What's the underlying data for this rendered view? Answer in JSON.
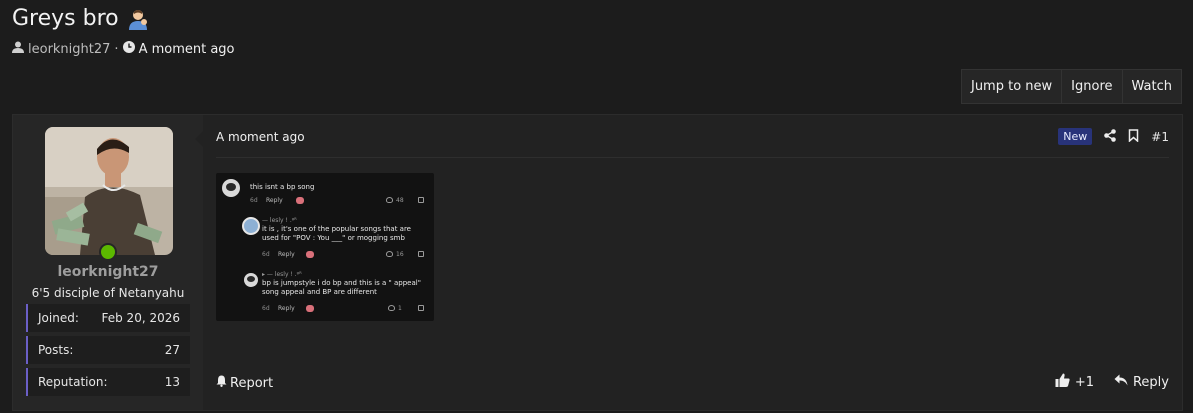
{
  "thread": {
    "title": "Greys bro",
    "author": "leorknight27",
    "separator": "·",
    "time": "A moment ago"
  },
  "actions": {
    "jump_to_new": "Jump to new",
    "ignore": "Ignore",
    "watch": "Watch"
  },
  "user": {
    "name": "leorknight27",
    "title": "6'5 disciple of Netanyahu",
    "stats": [
      {
        "label": "Joined:",
        "value": "Feb 20, 2026"
      },
      {
        "label": "Posts:",
        "value": "27"
      },
      {
        "label": "Reputation:",
        "value": "13"
      }
    ]
  },
  "post": {
    "time": "A moment ago",
    "badge": "New",
    "number": "#1",
    "report": "Report",
    "reaction_count": "+1",
    "reply": "Reply"
  },
  "embedded_screenshot": {
    "comments": [
      {
        "name": "",
        "text": "this isnt a bp song",
        "age": "6d",
        "reply": "Reply",
        "likes": "48"
      },
      {
        "name": "— lesly ! .ᵍᴿ",
        "text": "it is , it's one of the popular songs that are used for \"POV : You ___\" or mogging smb",
        "age": "6d",
        "reply": "Reply",
        "likes": "16"
      },
      {
        "name": "▸ — lesly ! .ᵍᴿ",
        "text": "bp is jumpstyle i do bp and this is a \" appeal\" song appeal and BP are different",
        "age": "6d",
        "reply": "Reply",
        "likes": "1"
      }
    ]
  },
  "colors": {
    "accent_bar": "#6b5fc7",
    "online": "#5cb800",
    "badge_bg": "#28337a"
  }
}
